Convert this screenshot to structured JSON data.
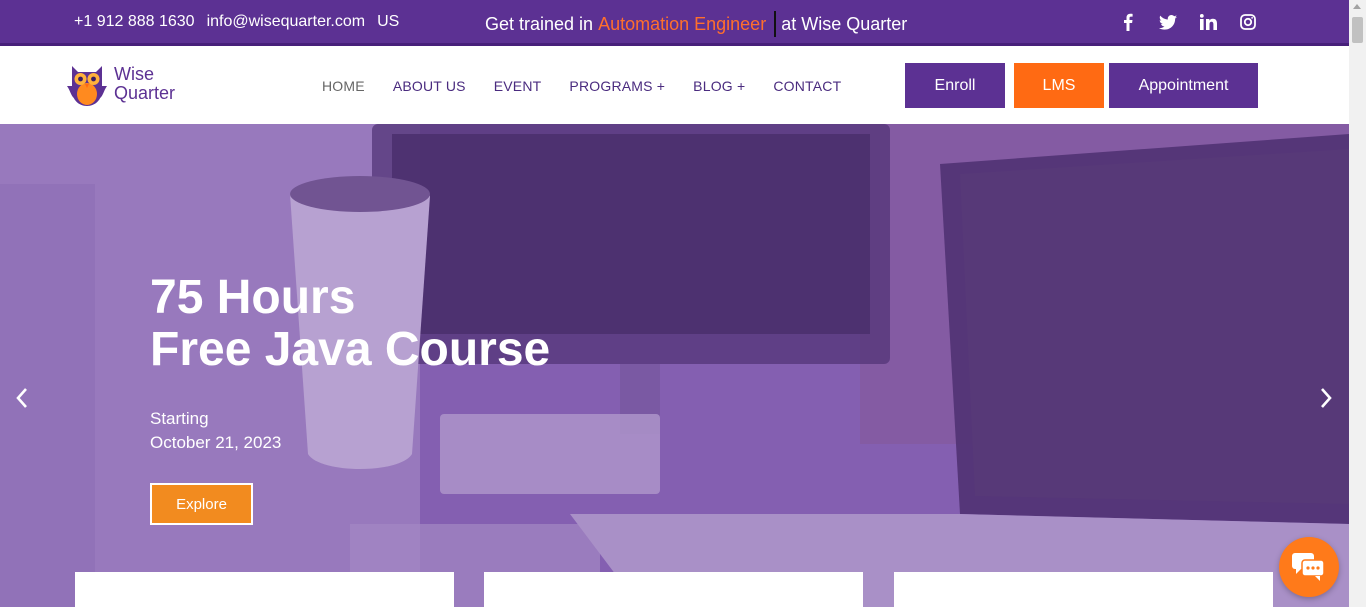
{
  "topbar": {
    "phone": "+1 912 888 1630",
    "email": "info@wisequarter.com",
    "region": "US",
    "promo_prefix": "Get trained in",
    "promo_highlight": "Automation Engineer",
    "promo_suffix": "at Wise Quarter",
    "social_icons": [
      "facebook-icon",
      "twitter-icon",
      "linkedin-icon",
      "instagram-icon"
    ]
  },
  "header": {
    "logo_line1": "Wise",
    "logo_line2": "Quarter",
    "nav": [
      {
        "label": "HOME"
      },
      {
        "label": "ABOUT US"
      },
      {
        "label": "EVENT"
      },
      {
        "label": "PROGRAMS +"
      },
      {
        "label": "BLOG +"
      },
      {
        "label": "CONTACT"
      }
    ],
    "buttons": {
      "enroll": "Enroll",
      "lms": "LMS",
      "appointment": "Appointment"
    }
  },
  "hero": {
    "title_line1": "75 Hours",
    "title_line2": "Free Java Course",
    "sub_line1": "Starting",
    "sub_line2": "October 21, 2023",
    "cta": "Explore"
  },
  "colors": {
    "brand_purple": "#5c3193",
    "accent_orange": "#ff6a13",
    "highlight_orange": "#ff6f2c",
    "explore_orange": "#f28b1f"
  }
}
